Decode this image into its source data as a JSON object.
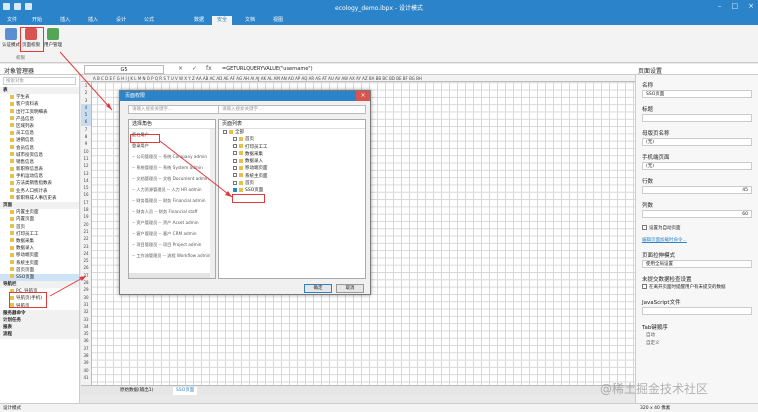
{
  "title": "ecology_demo.ibpx - 设计模式",
  "tabs": [
    "文件",
    "开始",
    "插入",
    "插入",
    "设计",
    "公式",
    "数据",
    "安全",
    "文档",
    "视图"
  ],
  "ribbon": {
    "buttons": [
      "认证模式",
      "页面权限",
      "用户管理"
    ],
    "group": "权限"
  },
  "formula": {
    "left_label": "对象管理器",
    "cell": "G5",
    "value": "=GETURLQUERYVALUE(\"username\")",
    "right_label": "页面设置"
  },
  "columns": "A B C D E F G H I J K L M N O P Q R S T U V W X Y Z AA AB AC AD AE AF AG AH AI AJ AK AL AM AN AO AP AQ AR AS AT AU AV AW AX AY AZ BA BB BC BD BE BF BG BH",
  "rows": [
    "1",
    "2",
    "3",
    "4",
    "5",
    "6",
    "7",
    "8",
    "9",
    "10",
    "11",
    "12",
    "13",
    "14",
    "15",
    "16",
    "17",
    "18",
    "19",
    "20",
    "21",
    "22",
    "23",
    "24",
    "25",
    "26",
    "27",
    "28",
    "29",
    "30",
    "31",
    "32",
    "33",
    "34",
    "35",
    "36",
    "37",
    "38",
    "39",
    "40",
    "41"
  ],
  "left": {
    "search": "搜索对象",
    "tree": [
      {
        "t": "表",
        "l": 0
      },
      {
        "t": "学生表",
        "l": 1
      },
      {
        "t": "客户资料表",
        "l": 1
      },
      {
        "t": "出行工资明细表",
        "l": 1
      },
      {
        "t": "产品信息",
        "l": 1
      },
      {
        "t": "区域列表",
        "l": 1
      },
      {
        "t": "员工信息",
        "l": 1
      },
      {
        "t": "进销信息",
        "l": 1
      },
      {
        "t": "会员信息",
        "l": 1
      },
      {
        "t": "城市投资信息",
        "l": 1
      },
      {
        "t": "销售信息",
        "l": 1
      },
      {
        "t": "新职称信息表",
        "l": 1
      },
      {
        "t": "手机运动信息",
        "l": 1
      },
      {
        "t": "方法类销售指数表",
        "l": 1
      },
      {
        "t": "业务人口统计表",
        "l": 1
      },
      {
        "t": "新职称成人事历史表",
        "l": 1
      },
      {
        "t": "页面",
        "l": 0
      },
      {
        "t": "内置主页面",
        "l": 1
      },
      {
        "t": "内置页面",
        "l": 1
      },
      {
        "t": "首页",
        "l": 1
      },
      {
        "t": "打印员工工",
        "l": 1
      },
      {
        "t": "数据采集",
        "l": 1
      },
      {
        "t": "数据录入",
        "l": 1
      },
      {
        "t": "移动端页面",
        "l": 1
      },
      {
        "t": "系统主页面",
        "l": 1
      },
      {
        "t": "首页页面",
        "l": 1
      },
      {
        "t": "SSO页面",
        "l": 1,
        "sel": true
      },
      {
        "t": "导航栏",
        "l": 0
      },
      {
        "t": "PC_导航页",
        "l": 1
      },
      {
        "t": "导航页(手机)",
        "l": 1
      },
      {
        "t": "导航页",
        "l": 1
      },
      {
        "t": "服务器命令",
        "l": 0
      },
      {
        "t": "计划任务",
        "l": 0
      },
      {
        "t": "报表",
        "l": 0
      },
      {
        "t": "流程",
        "l": 0
      }
    ]
  },
  "right": {
    "name_label": "名称",
    "name_value": "SSO页面",
    "title_label": "标题",
    "master_label": "母版页名称",
    "master_value": "(无)",
    "mobile_label": "手机端页面",
    "mobile_value": "(无)",
    "rows_label": "行数",
    "rows_value": "45",
    "cols_label": "列数",
    "cols_value": "60",
    "autofit": "设置为自动页面",
    "link": "编辑页面加载时命令...",
    "theme_label": "页面拉伸模式",
    "theme_value": "使用全局设置",
    "unsaved_label": "未提交数据检查设置",
    "unsaved_check": "在离开页面时提醒用户有未提交的数据",
    "js_label": "JavaScript文件",
    "tab_label": "Tab键顺序",
    "tab_opt1": "自动",
    "tab_opt2": "自定义"
  },
  "dialog": {
    "title": "页面权限",
    "role_search": "请输入搜索关键字...",
    "page_search": "请输入搜索关键字...",
    "roles_head": "选择角色",
    "pages_head": "页面列表",
    "roles": [
      "匿名用户",
      "登录用户",
      "-- 公司管理员 -- 系统 Company admin",
      "-- 系统管理员 -- 系统 System admin",
      "-- 文档管理员 -- 文档 Document admin",
      "-- 人力资源管理员 -- 人力 HR admin",
      "-- 财务管理员 -- 财务 Financial admin",
      "-- 财务人员 -- 财务 Financial staff",
      "-- 资产管理员 -- 资产 Asset admin",
      "-- 客户管理员 -- 客户 CRM admin",
      "-- 项目管理员 -- 项目 Project admin",
      "-- 工作流管理员 -- 流程 Workflow admin"
    ],
    "pages": [
      {
        "t": "全部",
        "l": 0,
        "c": false
      },
      {
        "t": "首页",
        "l": 1,
        "c": false
      },
      {
        "t": "打印员工工",
        "l": 1,
        "c": false
      },
      {
        "t": "数据采集",
        "l": 1,
        "c": false
      },
      {
        "t": "数据录入",
        "l": 1,
        "c": false
      },
      {
        "t": "移动端页面",
        "l": 1,
        "c": false
      },
      {
        "t": "系统主页面",
        "l": 1,
        "c": false
      },
      {
        "t": "首页",
        "l": 1,
        "c": false
      },
      {
        "t": "SSO页面",
        "l": 1,
        "c": true
      }
    ],
    "ok": "确定",
    "cancel": "取消"
  },
  "sheets": [
    "原始数据(输出1)",
    "SSO页面"
  ],
  "status": {
    "left": "设计模式",
    "size": "320 x 40 像素"
  },
  "watermark": "@稀土掘金技术社区"
}
